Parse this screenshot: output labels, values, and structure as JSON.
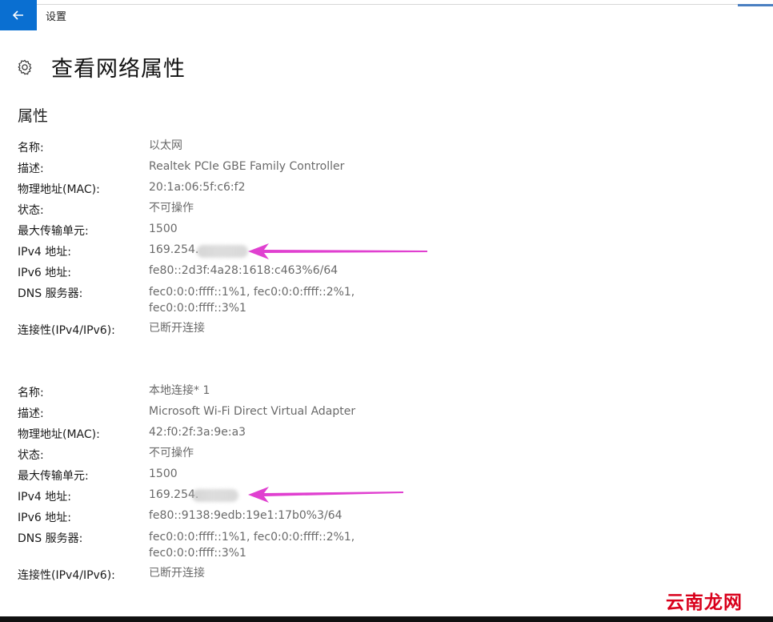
{
  "window": {
    "app_title": "设置"
  },
  "page": {
    "title": "查看网络属性",
    "section_title": "属性"
  },
  "adapters": [
    {
      "name_label": "名称:",
      "name": "以太网",
      "desc_label": "描述:",
      "desc": "Realtek PCIe GBE Family Controller",
      "mac_label": "物理地址(MAC):",
      "mac": "20:1a:06:5f:c6:f2",
      "state_label": "状态:",
      "state": "不可操作",
      "mtu_label": "最大传输单元:",
      "mtu": "1500",
      "ipv4_label": "IPv4 地址:",
      "ipv4": "169.254.",
      "ipv6_label": "IPv6 地址:",
      "ipv6": "fe80::2d3f:4a28:1618:c463%6/64",
      "dns_label": "DNS 服务器:",
      "dns_line1": "fec0:0:0:ffff::1%1, fec0:0:0:ffff::2%1,",
      "dns_line2": "fec0:0:0:ffff::3%1",
      "conn_label": "连接性(IPv4/IPv6):",
      "conn": "已断开连接"
    },
    {
      "name_label": "名称:",
      "name": "本地连接* 1",
      "desc_label": "描述:",
      "desc": "Microsoft Wi-Fi Direct Virtual Adapter",
      "mac_label": "物理地址(MAC):",
      "mac": "42:f0:2f:3a:9e:a3",
      "state_label": "状态:",
      "state": "不可操作",
      "mtu_label": "最大传输单元:",
      "mtu": "1500",
      "ipv4_label": "IPv4 地址:",
      "ipv4": "169.254.",
      "ipv6_label": "IPv6 地址:",
      "ipv6": "fe80::9138:9edb:19e1:17b0%3/64",
      "dns_label": "DNS 服务器:",
      "dns_line1": "fec0:0:0:ffff::1%1, fec0:0:0:ffff::2%1,",
      "dns_line2": "fec0:0:0:ffff::3%1",
      "conn_label": "连接性(IPv4/IPv6):",
      "conn": "已断开连接"
    }
  ],
  "watermark": "云南龙网",
  "colors": {
    "accent": "#0a6fd1",
    "annotation_arrow": "#e040d0",
    "watermark": "#d9001b"
  },
  "icons": {
    "back": "back-arrow-icon",
    "settings": "gear-icon"
  }
}
